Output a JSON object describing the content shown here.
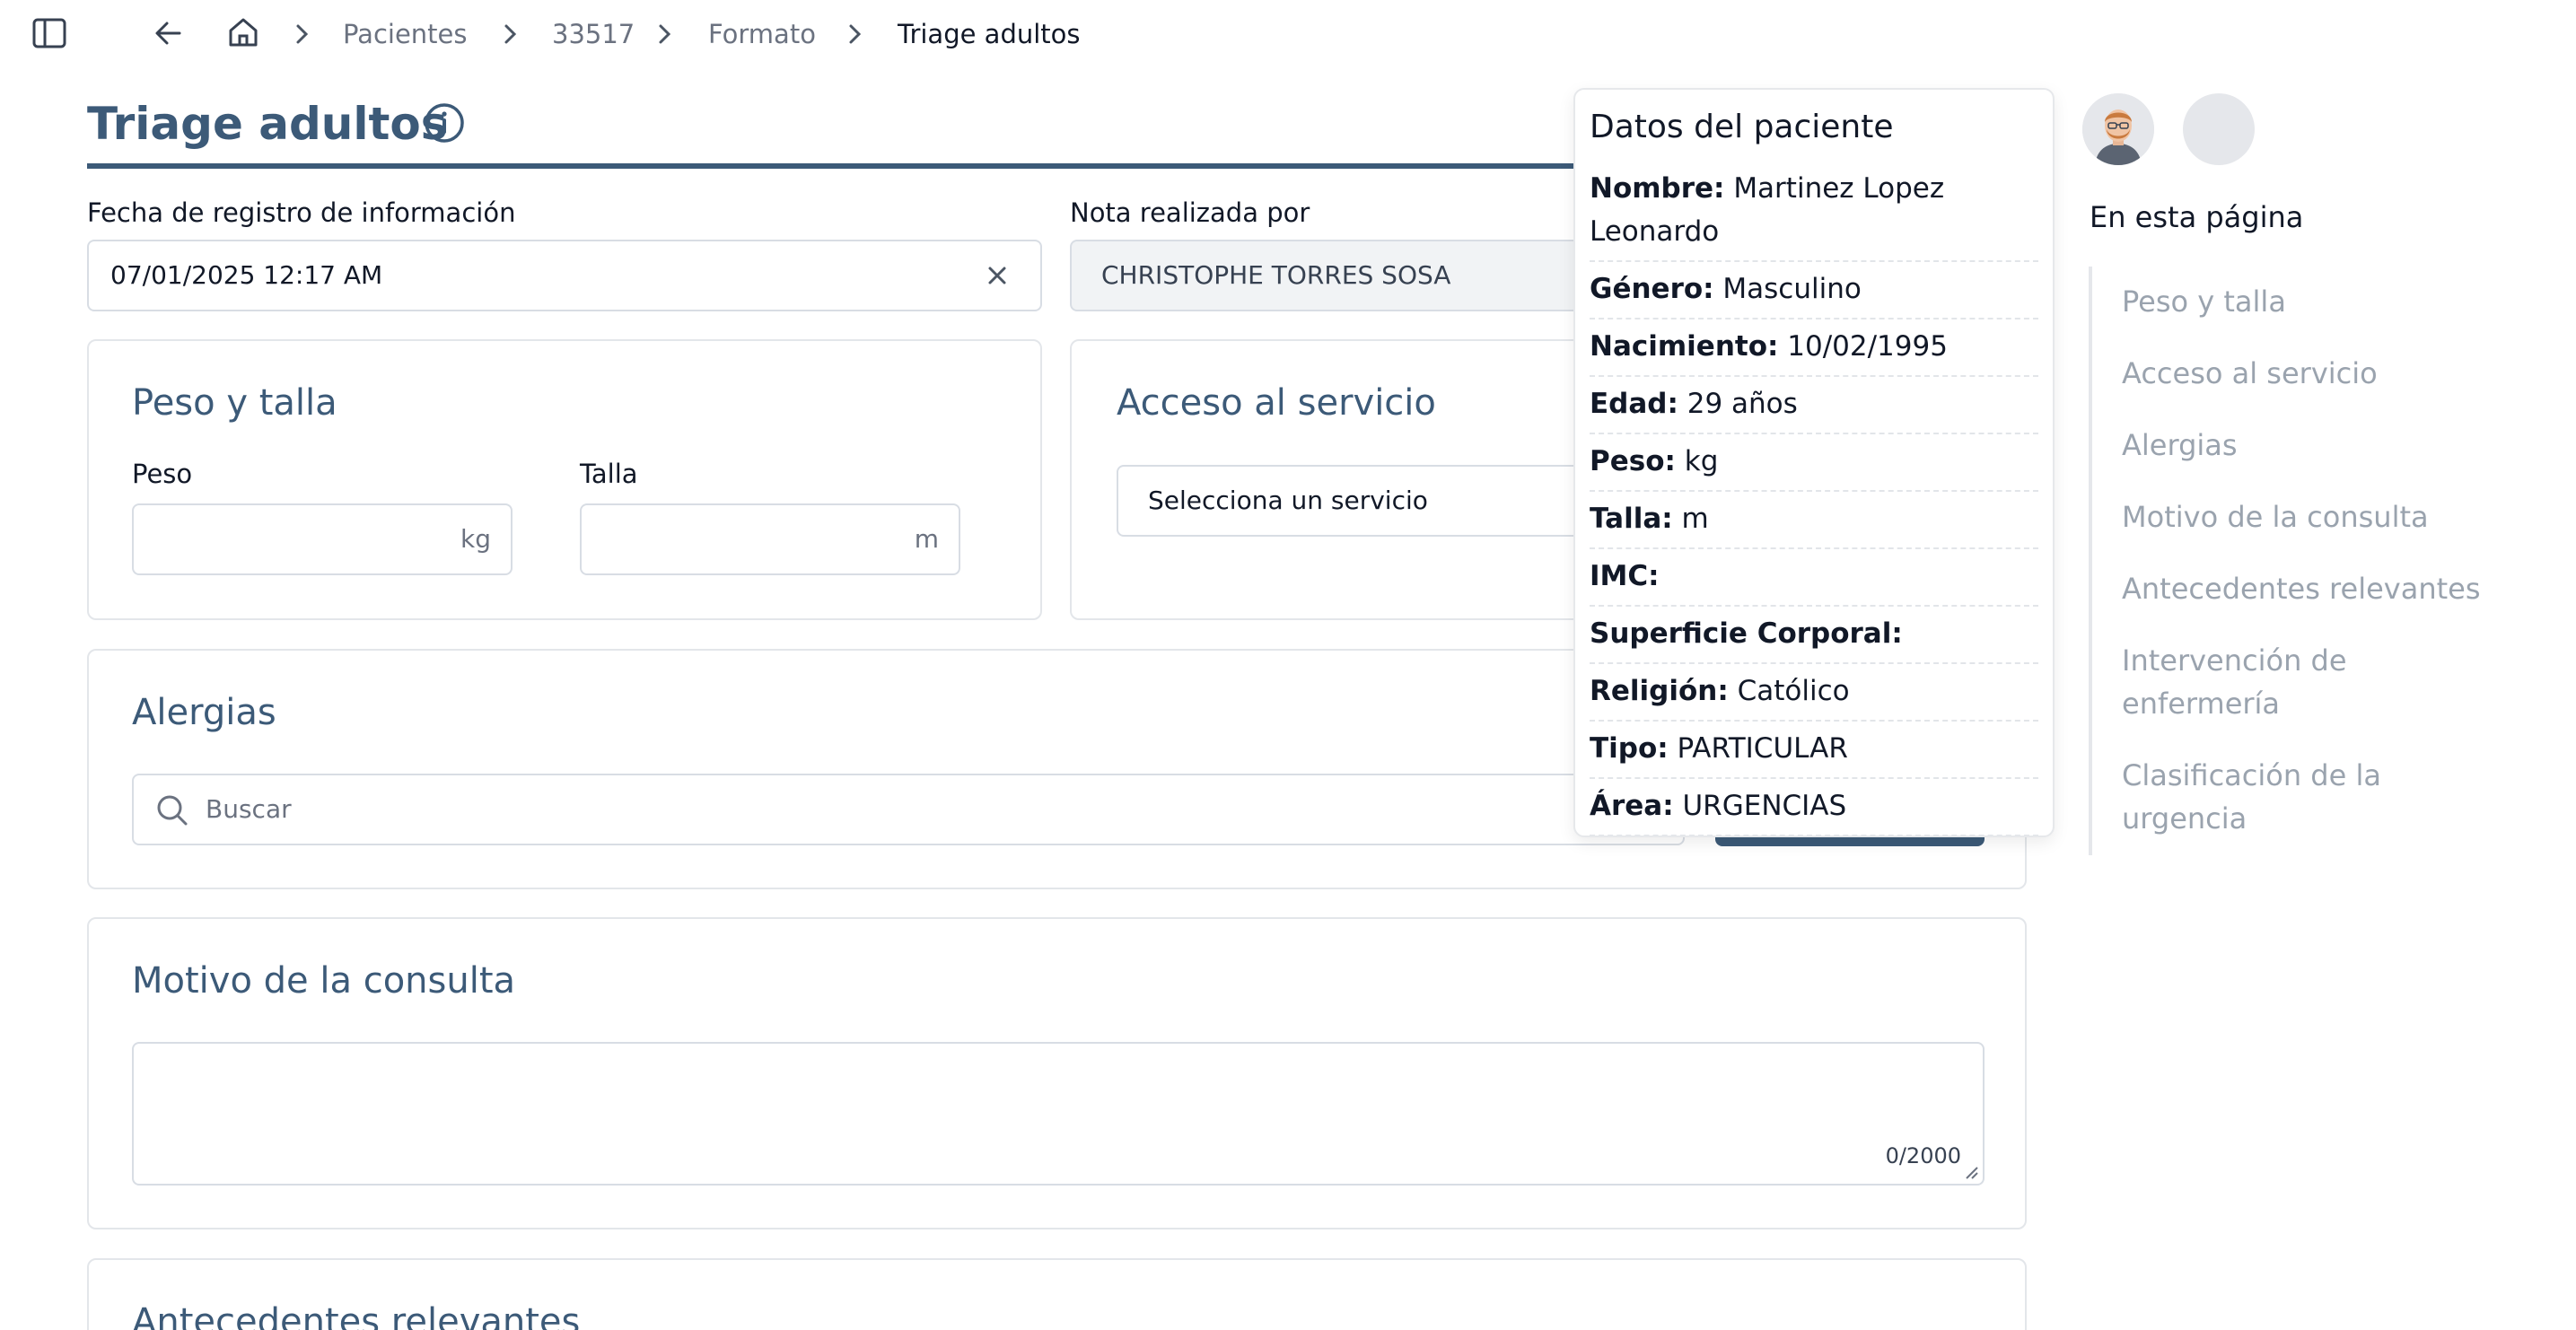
{
  "breadcrumb": {
    "items": [
      "Pacientes",
      "33517",
      "Formato",
      "Triage adultos"
    ]
  },
  "page": {
    "title": "Triage adultos"
  },
  "registro": {
    "fecha_label": "Fecha de registro de información",
    "fecha_value": "07/01/2025 12:17 AM",
    "nota_label": "Nota realizada por",
    "nota_value": "CHRISTOPHE TORRES SOSA"
  },
  "peso_talla": {
    "title": "Peso y talla",
    "peso_label": "Peso",
    "peso_suffix": "kg",
    "talla_label": "Talla",
    "talla_suffix": "m"
  },
  "acceso": {
    "title": "Acceso al servicio",
    "placeholder": "Selecciona un servicio"
  },
  "alergias": {
    "title": "Alergias",
    "search_placeholder": "Buscar"
  },
  "motivo": {
    "title": "Motivo de la consulta",
    "counter": "0/2000"
  },
  "antecedentes": {
    "title": "Antecedentes relevantes"
  },
  "patient_popover": {
    "title": "Datos del paciente",
    "fields": [
      {
        "label": "Nombre:",
        "value": "Martinez Lopez Leonardo"
      },
      {
        "label": "Género:",
        "value": "Masculino"
      },
      {
        "label": "Nacimiento:",
        "value": "10/02/1995"
      },
      {
        "label": "Edad:",
        "value": "29 años"
      },
      {
        "label": "Peso:",
        "value": "kg"
      },
      {
        "label": "Talla:",
        "value": "m"
      },
      {
        "label": "IMC:",
        "value": ""
      },
      {
        "label": "Superficie Corporal:",
        "value": ""
      },
      {
        "label": "Religión:",
        "value": "Católico"
      },
      {
        "label": "Tipo:",
        "value": "PARTICULAR"
      },
      {
        "label": "Área:",
        "value": "URGENCIAS"
      }
    ]
  },
  "toc": {
    "title": "En esta página",
    "items": [
      "Peso y talla",
      "Acceso al servicio",
      "Alergias",
      "Motivo de la consulta",
      "Antecedentes relevantes",
      "Intervención de enfermería",
      "Clasificación de la urgencia"
    ]
  },
  "colors": {
    "primary": "#3c5a78",
    "border": "#d8dde4",
    "muted": "#6b7280",
    "toc_muted": "#9aa3ae"
  }
}
